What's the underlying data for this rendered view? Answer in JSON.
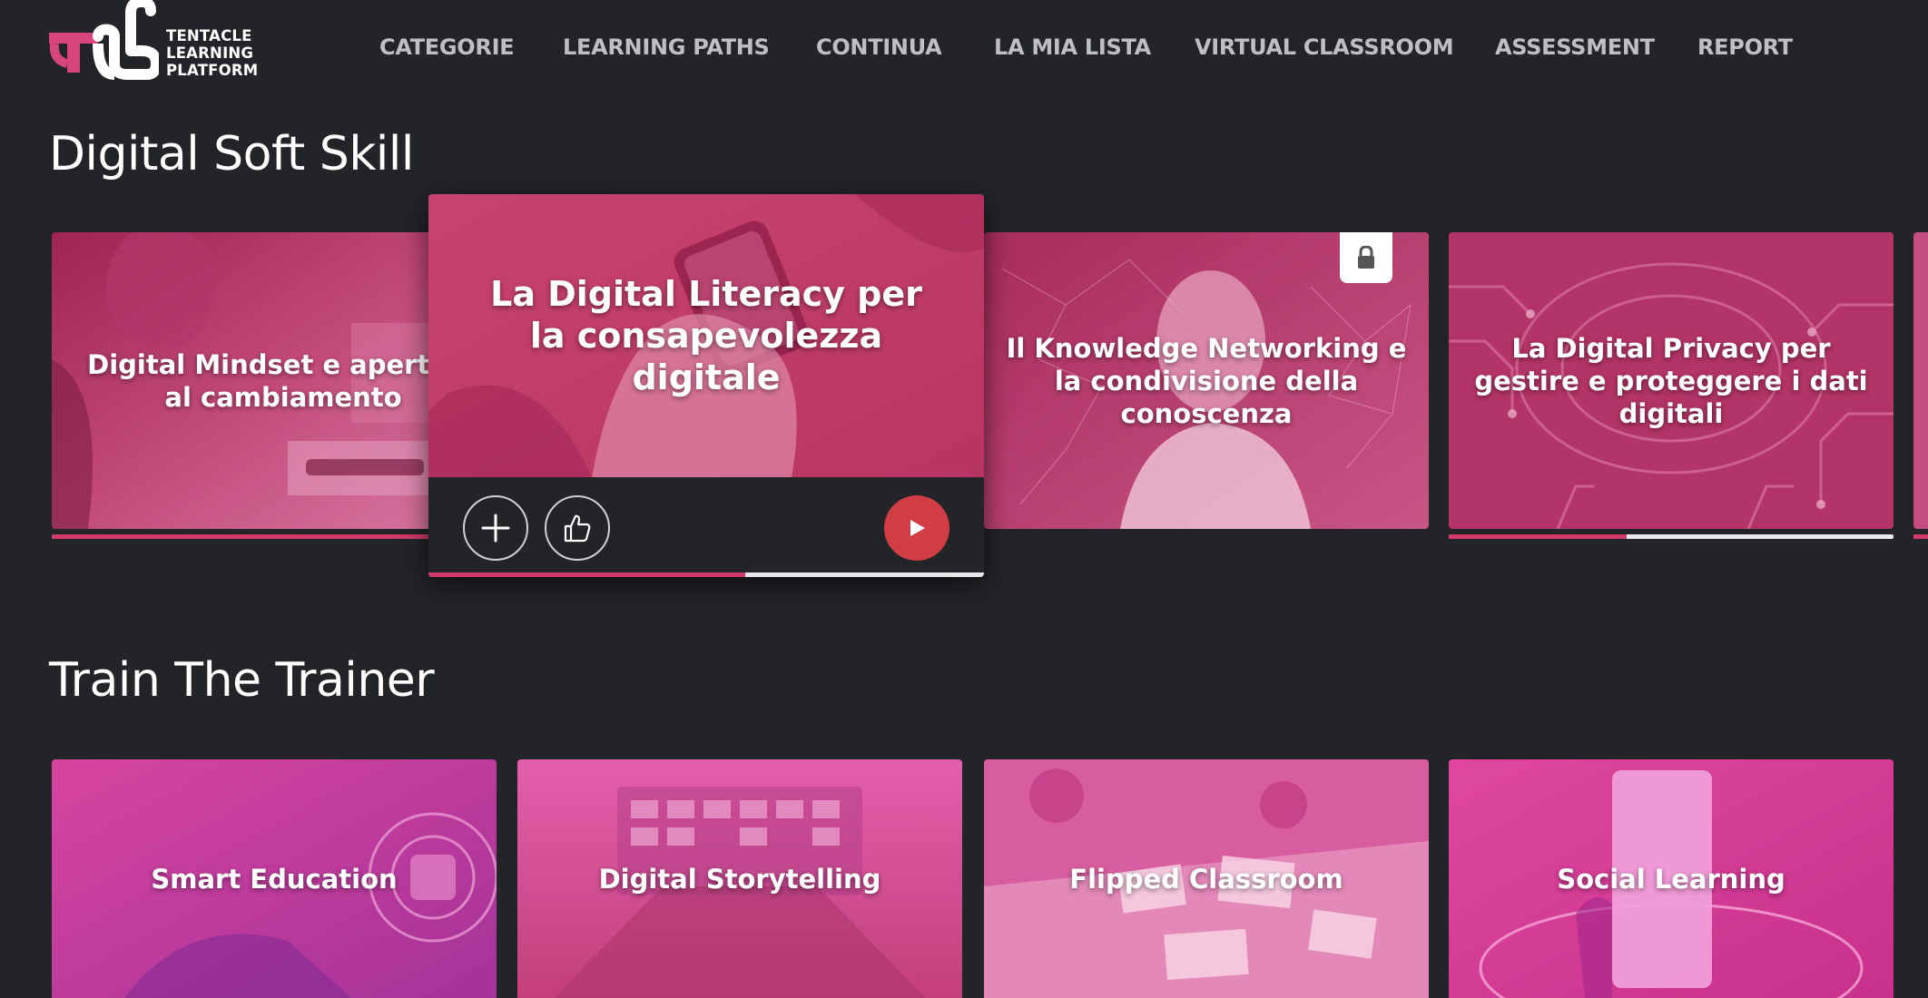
{
  "logo": {
    "lines": [
      "TENTACLE",
      "LEARNING",
      "PLATFORM"
    ],
    "icon": "tlp-logo-mark"
  },
  "nav": {
    "items": [
      {
        "label": "CATEGORIE"
      },
      {
        "label": "LEARNING PATHS"
      },
      {
        "label": "CONTINUA"
      },
      {
        "label": "LA MIA LISTA"
      },
      {
        "label": "VIRTUAL CLASSROOM"
      },
      {
        "label": "ASSESSMENT"
      },
      {
        "label": "REPORT"
      }
    ]
  },
  "sections": [
    {
      "title": "Digital Soft Skill",
      "cards": [
        {
          "title": "Digital Mindset e apertura al cambiamento",
          "progress": 0.88
        },
        {
          "title": "La Digital Literacy per la consapevolezza digitale",
          "progress": 0.57,
          "expanded": true
        },
        {
          "title": "Il Knowledge Networking e la condivisione della conoscenza",
          "locked": true
        },
        {
          "title": "La Digital Privacy per gestire e proteggere i dati digitali",
          "progress": 0.4
        }
      ]
    },
    {
      "title": "Train The Trainer",
      "cards": [
        {
          "title": "Smart Education"
        },
        {
          "title": "Digital Storytelling"
        },
        {
          "title": "Flipped Classroom"
        },
        {
          "title": "Social Learning"
        }
      ]
    }
  ],
  "icons": {
    "add": "plus-icon",
    "like": "thumbs-up-icon",
    "play": "play-icon",
    "lock": "lock-icon"
  },
  "colors": {
    "background": "#222428",
    "brand_pink": "#d13a6b",
    "nav_text": "#bfbfc3",
    "play_button": "#d13c45"
  }
}
